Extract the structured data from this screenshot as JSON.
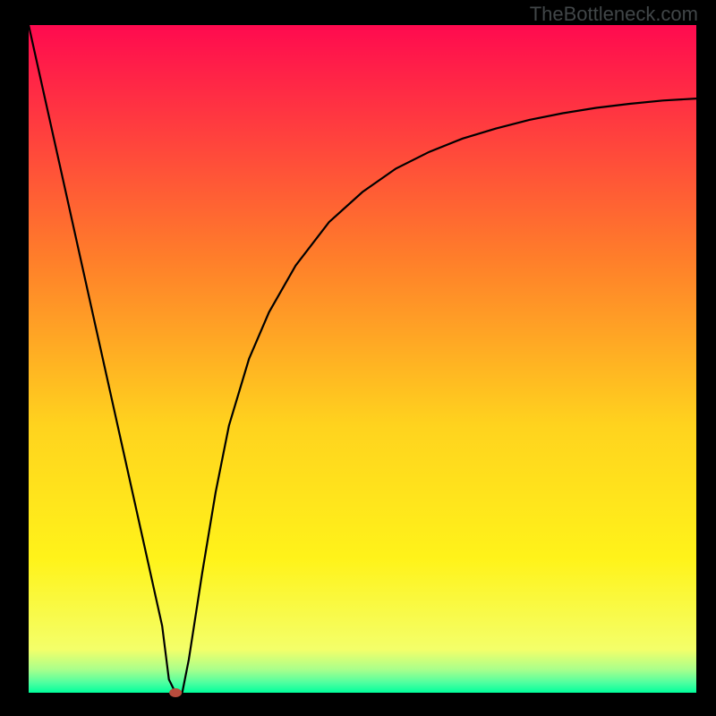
{
  "watermark": "TheBottleneck.com",
  "chart_data": {
    "type": "line",
    "title": "",
    "xlabel": "",
    "ylabel": "",
    "xlim": [
      0,
      100
    ],
    "ylim": [
      0,
      100
    ],
    "grid": false,
    "legend": false,
    "annotations": [],
    "background": "rainbow-gradient red→yellow→green (top→bottom)",
    "background_stops": [
      {
        "offset": 0.0,
        "color": "#ff0a4f"
      },
      {
        "offset": 0.35,
        "color": "#ff7e2a"
      },
      {
        "offset": 0.6,
        "color": "#ffd31e"
      },
      {
        "offset": 0.8,
        "color": "#fff31a"
      },
      {
        "offset": 0.935,
        "color": "#f4ff69"
      },
      {
        "offset": 0.965,
        "color": "#aaff8b"
      },
      {
        "offset": 0.985,
        "color": "#4fffa0"
      },
      {
        "offset": 1.0,
        "color": "#00ff9c"
      }
    ],
    "marker": {
      "x": 22,
      "y": 0,
      "color": "#b84c3d",
      "rx": 7,
      "ry": 5
    },
    "series": [
      {
        "name": "curve",
        "color": "#000000",
        "x": [
          0,
          5,
          10,
          15,
          18,
          20,
          21,
          22,
          23,
          24,
          26,
          28,
          30,
          33,
          36,
          40,
          45,
          50,
          55,
          60,
          65,
          70,
          75,
          80,
          85,
          90,
          95,
          100
        ],
        "y": [
          100,
          77.5,
          55,
          32.5,
          19,
          10,
          2,
          0,
          0,
          5,
          18,
          30,
          40,
          50,
          57,
          64,
          70.5,
          75,
          78.5,
          81,
          83,
          84.5,
          85.8,
          86.8,
          87.6,
          88.2,
          88.7,
          89
        ]
      }
    ]
  }
}
